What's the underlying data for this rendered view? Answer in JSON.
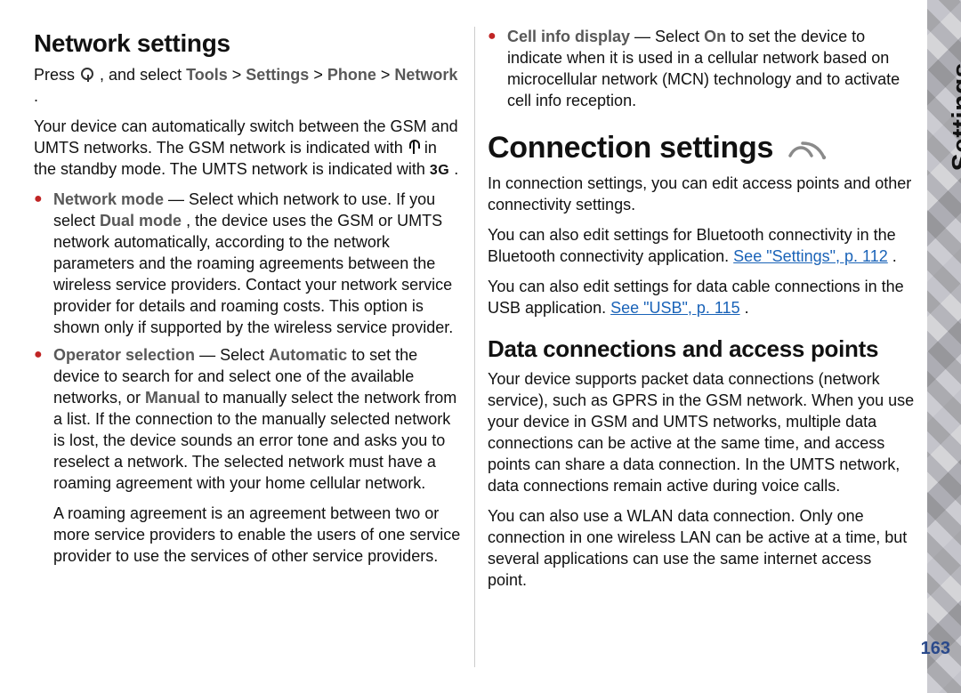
{
  "side_label": "Settings",
  "page_number": "163",
  "col1": {
    "h_network": "Network settings",
    "press": "Press ",
    "press_mid": " , and select ",
    "nav_tools": "Tools",
    "sep": " > ",
    "nav_settings": "Settings",
    "nav_phone": "Phone",
    "nav_network": "Network",
    "nav_end": ".",
    "p_auto": "Your device can automatically switch between the GSM and UMTS networks. The GSM network is indicated with ",
    "p_auto_mid": " in the standby mode. The UMTS network is indicated with ",
    "p_auto_end": ".",
    "li_netmode_b": "Network mode",
    "li_netmode_dash": " — Select which network to use. If you select ",
    "li_netmode_dual": "Dual mode",
    "li_netmode_tail": ", the device uses the GSM or UMTS network automatically, according to the network parameters and the roaming agreements between the wireless service providers. Contact your network service provider for details and roaming costs. This option is shown only if supported by the wireless service provider.",
    "li_op_b": "Operator selection",
    "li_op_dash": " — Select ",
    "li_op_auto": "Automatic",
    "li_op_mid": " to set the device to search for and select one of the available networks, or ",
    "li_op_manual": "Manual",
    "li_op_tail": " to manually select the network from a list. If the connection to the manually selected network is lost, the device sounds an error tone and asks you to reselect a network. The selected network must have a roaming agreement with your home cellular network.",
    "li_op_extra": "A roaming agreement is an agreement between two or more service providers to enable the users of one service provider to use the services of other service providers."
  },
  "col2": {
    "li_cell_b": "Cell info display",
    "li_cell_dash": " — Select ",
    "li_cell_on": "On",
    "li_cell_tail": " to set the device to indicate when it is used in a cellular network based on microcellular network (MCN) technology and to activate cell info reception.",
    "h_conn": "Connection settings",
    "p_conn1": "In connection settings, you can edit access points and other connectivity settings.",
    "p_conn2_a": "You can also edit settings for Bluetooth connectivity in the Bluetooth connectivity application. ",
    "link_settings": "See \"Settings\", p. 112",
    "p_conn2_end": ".",
    "p_conn3_a": "You can also edit settings for data cable connections in the USB application. ",
    "link_usb": "See \"USB\", p. 115",
    "p_conn3_end": ".",
    "h_data": "Data connections and access points",
    "p_data1": "Your device supports packet data connections (network service), such as GPRS in the GSM network. When you use your device in GSM and UMTS networks, multiple data connections can be active at the same time, and access points can share a data connection. In the UMTS network, data connections remain active during voice calls.",
    "p_data2": "You can also use a WLAN data connection. Only one connection in one wireless LAN can be active at a time, but several applications can use the same internet access point."
  }
}
